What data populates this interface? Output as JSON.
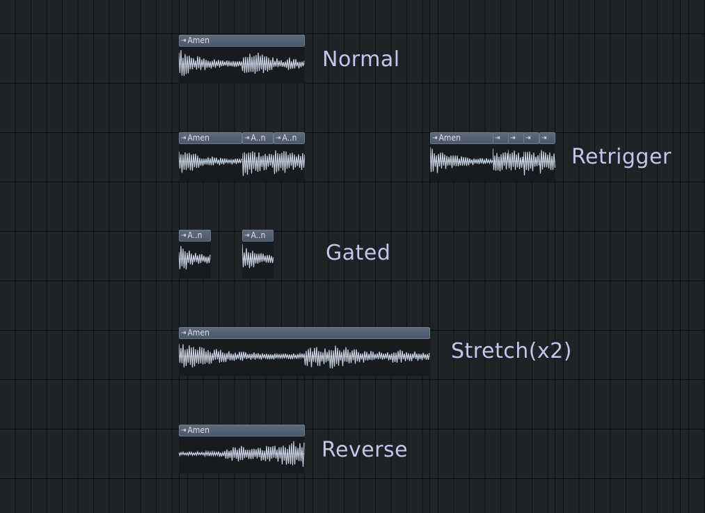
{
  "rows": [
    {
      "id": "normal",
      "label": "Normal",
      "clips": [
        {
          "name": "Amen",
          "type": "normal"
        }
      ]
    },
    {
      "id": "retrigger",
      "label": "Retrigger",
      "clips": [
        {
          "name": "Amen",
          "type": "normal"
        },
        {
          "name": "A..n",
          "type": "burst"
        },
        {
          "name": "A..n",
          "type": "burst"
        },
        {
          "name": "Amen",
          "type": "normal"
        },
        {
          "name": "",
          "type": "burst"
        },
        {
          "name": "",
          "type": "burst"
        },
        {
          "name": "",
          "type": "burst"
        },
        {
          "name": "",
          "type": "burst"
        }
      ]
    },
    {
      "id": "gated",
      "label": "Gated",
      "clips": [
        {
          "name": "A..n",
          "type": "gate"
        },
        {
          "name": "A..n",
          "type": "gate"
        }
      ]
    },
    {
      "id": "stretch",
      "label": "Stretch(x2)",
      "clips": [
        {
          "name": "Amen",
          "type": "stretch"
        }
      ]
    },
    {
      "id": "reverse",
      "label": "Reverse",
      "clips": [
        {
          "name": "Amen",
          "type": "reverse"
        }
      ]
    }
  ],
  "theme": {
    "background": "#1f2327",
    "clip_header": "#52606f",
    "waveform": "#c9d3e2",
    "label_color": "#c7c4ec"
  },
  "icons": {
    "clip_flag": "double-arrow-right-icon"
  }
}
